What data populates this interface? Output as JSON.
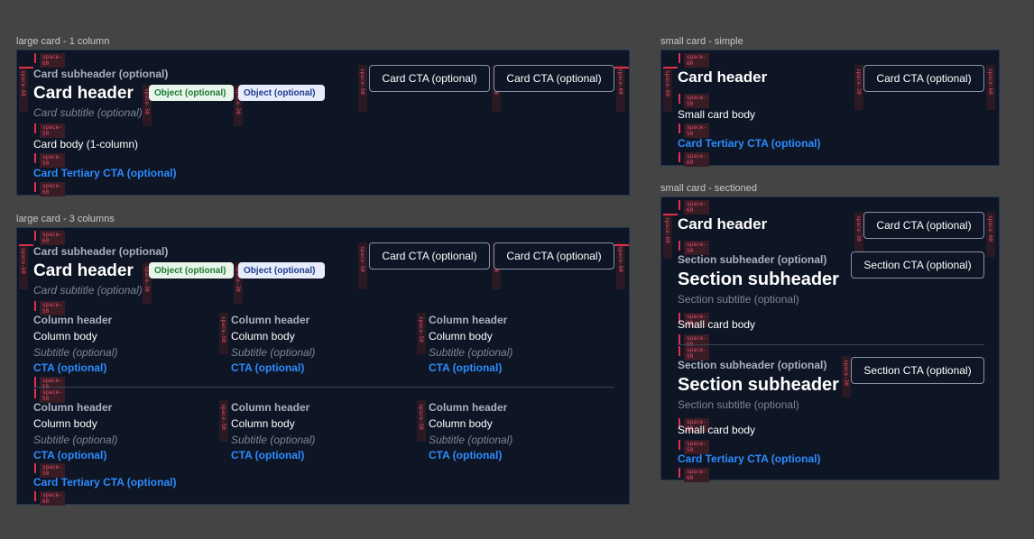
{
  "frames": {
    "large1": {
      "label": "large card - 1 column"
    },
    "large3": {
      "label": "large card - 3 columns"
    },
    "smallSimple": {
      "label": "small card - simple"
    },
    "smallSectioned": {
      "label": "small card - sectioned"
    }
  },
  "common": {
    "card_subheader": "Card subheader (optional)",
    "card_header": "Card header",
    "card_subtitle": "Card subtitle (optional)",
    "object_label": "Object (optional)",
    "card_cta": "Card CTA (optional)",
    "tertiary_cta": "Card Tertiary CTA (optional)"
  },
  "large1": {
    "body": "Card body (1-column)"
  },
  "large3": {
    "column_header": "Column header",
    "column_body": "Column body",
    "column_subtitle": "Subtitle (optional)",
    "column_cta": "CTA (optional)"
  },
  "smallSimple": {
    "body": "Small card body"
  },
  "smallSectioned": {
    "section_subheader_small": "Section subheader (optional)",
    "section_subheader": "Section subheader",
    "section_subtitle": "Section subtitle (optional)",
    "section_cta": "Section CTA (optional)",
    "body": "Small card body"
  },
  "spacing": {
    "s60": "space-60",
    "s50": "space-50",
    "s30": "space-30",
    "s20": "space-20"
  },
  "colors": {
    "canvas": "#444444",
    "card": "#0e1524",
    "accent": "#2d8cff",
    "spacing_marker": "#e0304a"
  }
}
